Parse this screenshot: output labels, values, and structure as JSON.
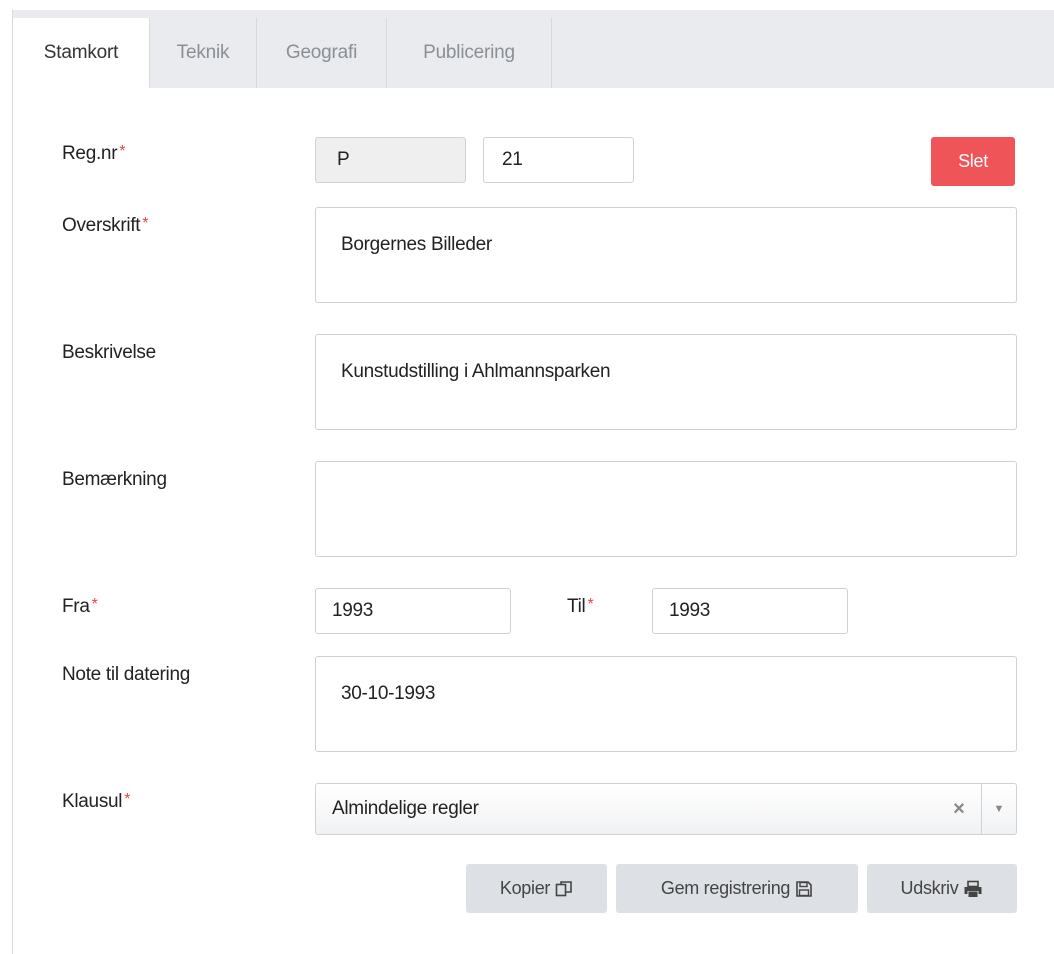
{
  "tabs": [
    {
      "label": "Stamkort",
      "active": true
    },
    {
      "label": "Teknik",
      "active": false
    },
    {
      "label": "Geografi",
      "active": false
    },
    {
      "label": "Publicering",
      "active": false
    }
  ],
  "form": {
    "required_marker": "*",
    "regnr": {
      "label": "Reg.nr",
      "prefix": "P",
      "number": "21"
    },
    "overskrift": {
      "label": "Overskrift",
      "value": "Borgernes Billeder"
    },
    "beskrivelse": {
      "label": "Beskrivelse",
      "value": "Kunstudstilling i Ahlmannsparken"
    },
    "bemaerkning": {
      "label": "Bemærkning",
      "value": ""
    },
    "fra": {
      "label": "Fra",
      "value": "1993"
    },
    "til": {
      "label": "Til",
      "value": "1993"
    },
    "note_datering": {
      "label": "Note til datering",
      "value": "30-10-1993"
    },
    "klausul": {
      "label": "Klausul",
      "value": "Almindelige regler"
    }
  },
  "buttons": {
    "delete": "Slet",
    "copy": "Kopier",
    "save": "Gem registrering",
    "print": "Udskriv"
  },
  "icons": {
    "copy": "copy-icon",
    "save": "floppy-disk-icon",
    "print": "printer-icon",
    "clear": "clear-x-icon",
    "dropdown": "caret-down-icon"
  },
  "colors": {
    "danger": "#ef5459",
    "required": "#e0483f",
    "tabbar": "#e9ebee",
    "button": "#dde1e5"
  }
}
